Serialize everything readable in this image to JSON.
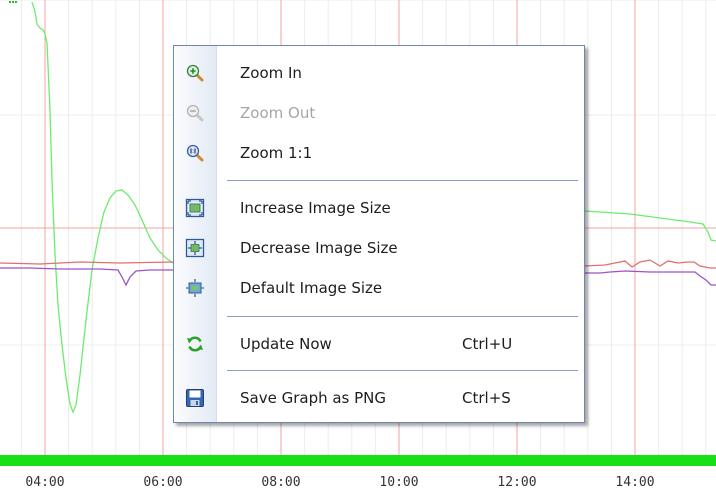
{
  "graph": {
    "x_ticks": [
      "04:00",
      "06:00",
      "08:00",
      "10:00",
      "12:00",
      "14:00"
    ],
    "colors": {
      "background": "#ffffff",
      "minor_grid": "#ececec",
      "major_grid": "#f3a3a3",
      "green_line": "#6eeb6e",
      "red_line": "#e07070",
      "purple_line": "#9b55c8",
      "status_bar": "#17e017",
      "axis_text": "#333333"
    }
  },
  "context_menu": {
    "items": [
      {
        "label": "Zoom In",
        "shortcut": "",
        "enabled": true,
        "icon": "zoom-in-icon"
      },
      {
        "label": "Zoom Out",
        "shortcut": "",
        "enabled": false,
        "icon": "zoom-out-icon"
      },
      {
        "label": "Zoom 1:1",
        "shortcut": "",
        "enabled": true,
        "icon": "zoom-reset-icon"
      },
      {
        "label": "Increase Image Size",
        "shortcut": "",
        "enabled": true,
        "icon": "increase-size-icon"
      },
      {
        "label": "Decrease Image Size",
        "shortcut": "",
        "enabled": true,
        "icon": "decrease-size-icon"
      },
      {
        "label": "Default Image Size",
        "shortcut": "",
        "enabled": true,
        "icon": "default-size-icon"
      },
      {
        "label": "Update Now",
        "shortcut": "Ctrl+U",
        "enabled": true,
        "icon": "refresh-icon"
      },
      {
        "label": "Save Graph as PNG",
        "shortcut": "Ctrl+S",
        "enabled": true,
        "icon": "save-icon"
      }
    ]
  }
}
